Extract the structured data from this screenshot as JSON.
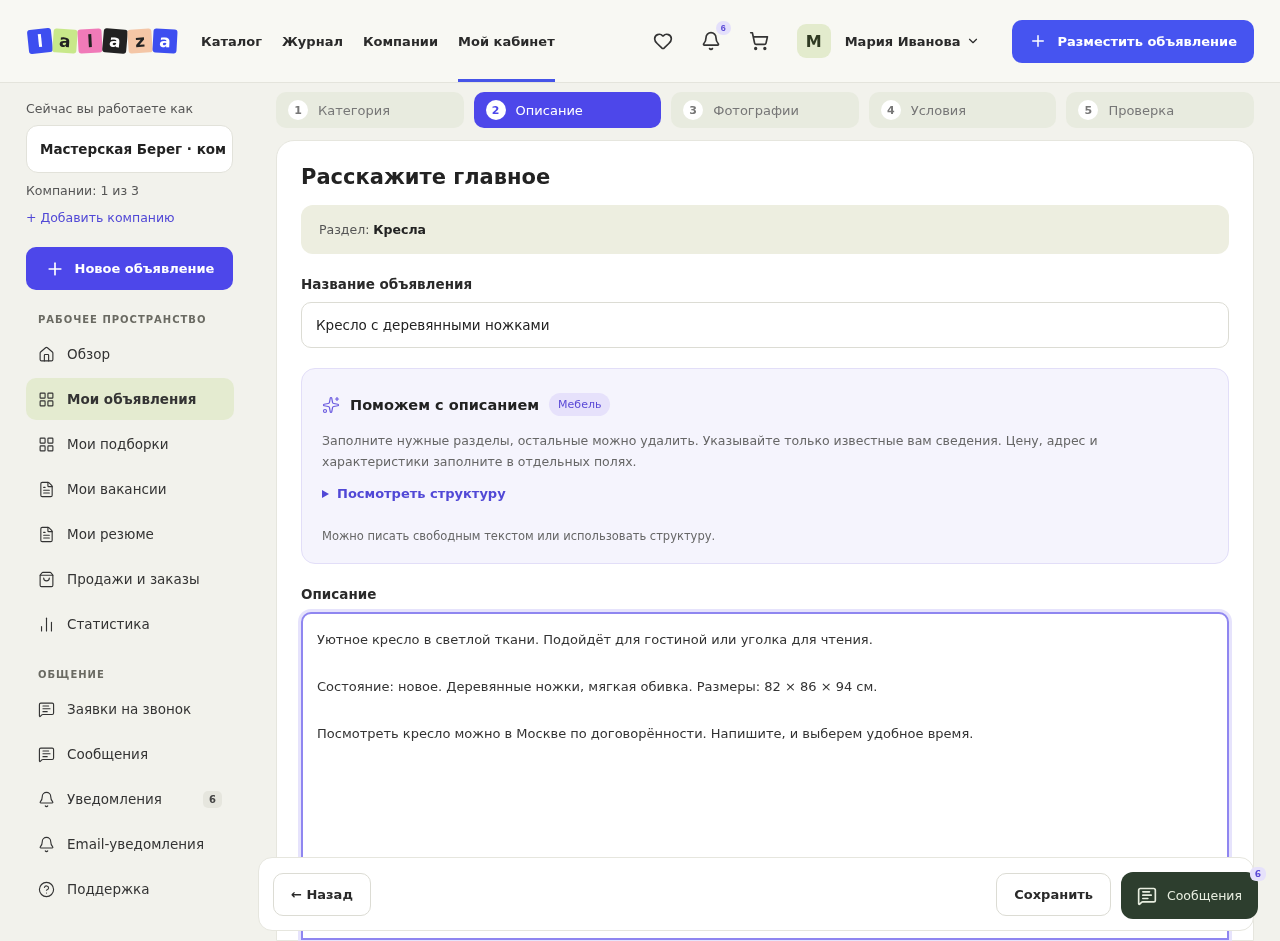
{
  "header": {
    "logo": [
      "l",
      "a",
      "l",
      "a",
      "z",
      "a"
    ],
    "nav": [
      {
        "label": "Каталог",
        "selected": false
      },
      {
        "label": "Журнал",
        "selected": false
      },
      {
        "label": "Компании",
        "selected": false
      },
      {
        "label": "Мой кабинет",
        "selected": true
      }
    ],
    "notifications_count": "6",
    "avatar_letter": "M",
    "user_name": "Мария Иванова",
    "post_button": "Разместить объявление"
  },
  "sidebar": {
    "working_as_label": "Сейчас вы работаете как",
    "company_select": "Мастерская Берег · ком",
    "companies_count": "Компании: 1 из 3",
    "add_company": "+ Добавить компанию",
    "new_ad_button": "Новое объявление",
    "sections": [
      {
        "title": "РАБОЧЕЕ ПРОСТРАНСТВО",
        "items": [
          {
            "label": "Обзор",
            "kind": "home",
            "selected": false
          },
          {
            "label": "Мои объявления",
            "kind": "grid",
            "selected": true
          },
          {
            "label": "Мои подборки",
            "kind": "grid",
            "selected": false
          },
          {
            "label": "Мои вакансии",
            "kind": "doc",
            "selected": false
          },
          {
            "label": "Мои резюме",
            "kind": "doc",
            "selected": false
          },
          {
            "label": "Продажи и заказы",
            "kind": "bag",
            "selected": false
          },
          {
            "label": "Статистика",
            "kind": "chart",
            "selected": false
          }
        ]
      },
      {
        "title": "ОБЩЕНИЕ",
        "items": [
          {
            "label": "Заявки на звонок",
            "kind": "chat",
            "selected": false
          },
          {
            "label": "Сообщения",
            "kind": "chat",
            "selected": false
          },
          {
            "label": "Уведомления",
            "kind": "bell",
            "selected": false,
            "badge": "6"
          },
          {
            "label": "Email-уведомления",
            "kind": "bell",
            "selected": false
          },
          {
            "label": "Поддержка",
            "kind": "help",
            "selected": false
          }
        ]
      }
    ]
  },
  "steps": [
    {
      "number": "1",
      "label": "Категория",
      "selected": false
    },
    {
      "number": "2",
      "label": "Описание",
      "selected": true
    },
    {
      "number": "3",
      "label": "Фотографии",
      "selected": false
    },
    {
      "number": "4",
      "label": "Условия",
      "selected": false
    },
    {
      "number": "5",
      "label": "Проверка",
      "selected": false
    }
  ],
  "form": {
    "title": "Расскажите главное",
    "section_note": "Раздел: **Кресла**",
    "name_label": "Название объявления",
    "name_value": "Кресло с деревянными ножками",
    "helper": {
      "title": "Поможем с описанием",
      "tag": "Мебель",
      "text": "Заполните нужные разделы, остальные можно удалить. Указывайте только известные вам сведения. Цену, адрес и характеристики заполните в отдельных полях.",
      "toggle": "Посмотреть структуру",
      "expanded": false,
      "footnote": "Можно писать свободным текстом или использовать структуру."
    },
    "description_label": "Описание",
    "description_value": "Уютное кресло в светлой ткани. Подойдёт для гостиной или уголка для чтения.\n\nСостояние: новое. Деревянные ножки, мягкая обивка. Размеры: 82 × 86 × 94 см.\n\nПосмотреть кресло можно в Москве по договорённости. Напишите, и выберем удобное время."
  },
  "actions": {
    "back": "← Назад",
    "save": "Сохранить"
  },
  "chat_button": {
    "label": "Сообщения",
    "count": "6"
  }
}
